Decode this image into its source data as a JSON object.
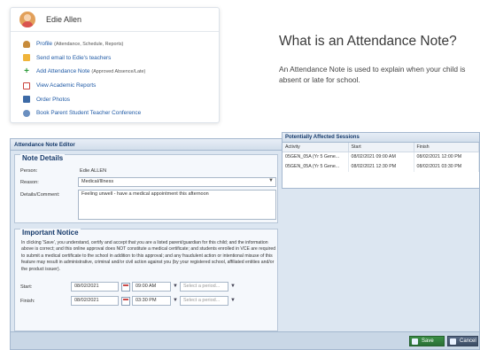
{
  "card": {
    "student_name": "Edie Allen",
    "items": [
      {
        "label": "Profile",
        "sub": "(Attendance, Schedule, Reports)",
        "icon": "profile-icon"
      },
      {
        "label": "Send email to Edie's teachers",
        "sub": "",
        "icon": "mail-icon"
      },
      {
        "label": "Add Attendance Note",
        "sub": "(Approved Absence/Late)",
        "icon": "plus-icon"
      },
      {
        "label": "View Academic Reports",
        "sub": "",
        "icon": "report-icon"
      },
      {
        "label": "Order Photos",
        "sub": "",
        "icon": "photo-icon"
      },
      {
        "label": "Book Parent Student Teacher Conference",
        "sub": "",
        "icon": "conference-icon"
      }
    ]
  },
  "heading": "What is an Attendance Note?",
  "intro": "An Attendance Note is used to explain when your child is absent or late for school.",
  "editor": {
    "title": "Attendance Note Editor",
    "close": "✕",
    "note_details": {
      "legend": "Note Details",
      "person_label": "Person:",
      "person_value": "Edie ALLEN",
      "reason_label": "Reason:",
      "reason_value": "Medical/Illness",
      "details_label": "Details/Comment:",
      "details_value": "Feeling unwell - have a medical appointment this afternoon"
    },
    "notice": {
      "legend": "Important Notice",
      "text": "In clicking 'Save', you understand, certify and accept that you are a listed parent/guardian for this child; and the information above is correct; and this online approval does NOT constitute a medical certificate; and students enrolled in VCE are required to submit a medical certificate to the school in addition to this approval; and any fraudulent action or intentional misuse of this feature may result in administrative, criminal and/or civil action against you (by your registered school, affiliated entities and/or the product issuer)."
    },
    "start": {
      "label": "Start:",
      "date": "08/02/2021",
      "time": "09:00 AM",
      "period_placeholder": "Select a period..."
    },
    "finish": {
      "label": "Finish:",
      "date": "08/02/2021",
      "time": "03:30 PM",
      "period_placeholder": "Select a period..."
    },
    "sessions": {
      "title": "Potentially Affected Sessions",
      "columns": [
        "Activity",
        "Start",
        "Finish"
      ],
      "rows": [
        [
          "05GEN_05A (Yr 5 Gene...",
          "08/02/2021 09:00 AM",
          "08/02/2021 12:00 PM"
        ],
        [
          "05GEN_05A (Yr 5 Gene...",
          "08/02/2021 12:30 PM",
          "08/02/2021 03:30 PM"
        ]
      ]
    },
    "save_label": "Save",
    "cancel_label": "Cancel"
  }
}
